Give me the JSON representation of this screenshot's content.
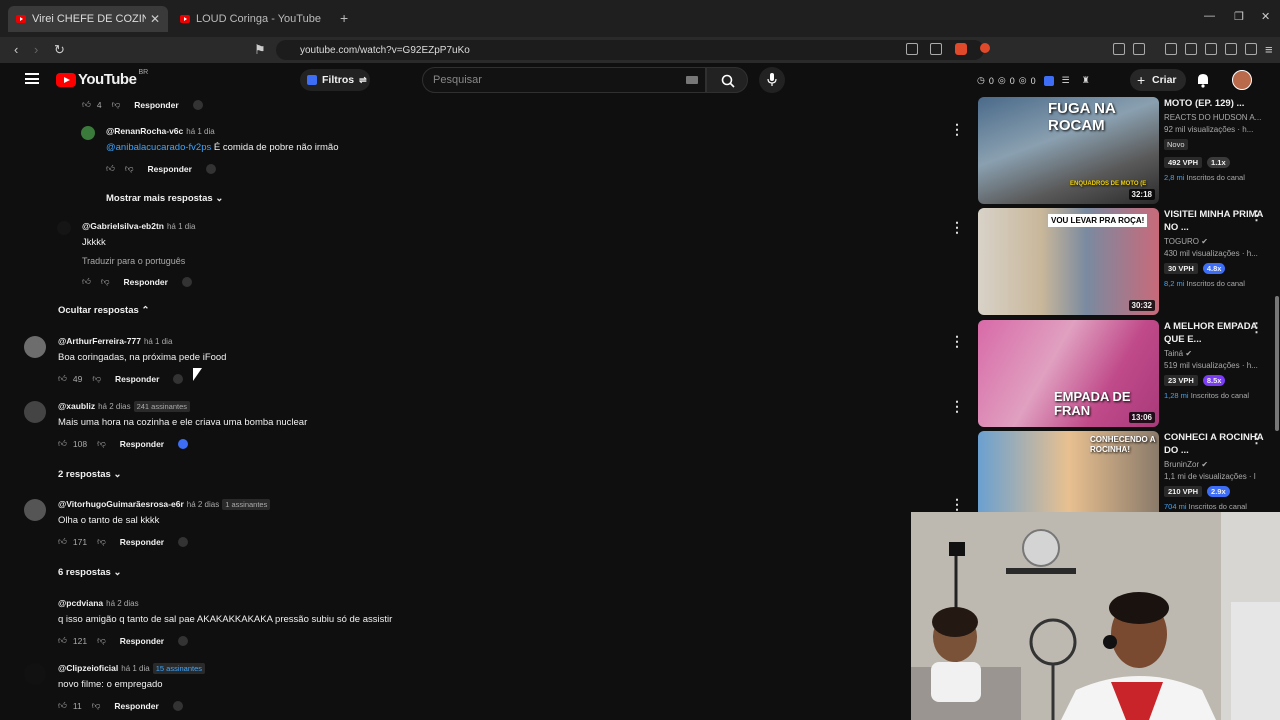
{
  "browser": {
    "tabs": [
      {
        "title": "Virei CHEFE DE COZINHA para S",
        "active": true
      },
      {
        "title": "LOUD Coringa - YouTube",
        "active": false
      }
    ],
    "url": "youtube.com/watch?v=G92EZpP7uKo"
  },
  "header": {
    "logo_text": "YouTube",
    "region": "BR",
    "filtros_label": "Filtros",
    "search_placeholder": "Pesquisar",
    "stats": [
      "0",
      "0",
      "0"
    ],
    "criar_label": "Criar"
  },
  "comments": [
    {
      "type": "actions",
      "likes": "4",
      "reply": "Responder"
    },
    {
      "type": "comment",
      "user": "@RenanRocha-v6c",
      "when": "há 1 dia",
      "mention": "@anibalacucarado-fv2ps",
      "text": "É comida de pobre não irmão",
      "likes": "",
      "reply": "Responder"
    },
    {
      "type": "toggle",
      "label": "Mostrar mais respostas"
    },
    {
      "type": "comment",
      "user": "@Gabrielsilva-eb2tn",
      "when": "há 1 dia",
      "text": "Jkkkk",
      "translate": "Traduzir para o português",
      "likes": "",
      "reply": "Responder"
    },
    {
      "type": "toggle",
      "label": "Ocultar respostas"
    },
    {
      "type": "comment",
      "user": "@ArthurFerreira-777",
      "when": "há 1 dia",
      "text": "Boa coringadas, na próxima pede iFood",
      "likes": "49",
      "reply": "Responder"
    },
    {
      "type": "comment",
      "user": "@xaubliz",
      "when": "há 2 dias",
      "subscribers": "241 assinantes",
      "text": "Mais uma hora na cozinha e ele criava uma bomba nuclear",
      "likes": "108",
      "reply": "Responder"
    },
    {
      "type": "toggle",
      "label": "2 respostas"
    },
    {
      "type": "comment",
      "user": "@VitorhugoGuimarãesrosa-e6r",
      "when": "há 2 dias",
      "subscribers": "1 assinantes",
      "text": "Olha o tanto de sal kkkk",
      "likes": "171",
      "reply": "Responder"
    },
    {
      "type": "toggle",
      "label": "6 respostas"
    },
    {
      "type": "comment",
      "user": "@pcdviana",
      "when": "há 2 dias",
      "text": "q isso amigão q tanto de sal pae AKAKAKKAKAKA pressão subiu só de assistir",
      "likes": "121",
      "reply": "Responder"
    },
    {
      "type": "comment",
      "user": "@Clipzeioficial",
      "when": "há 1 dia",
      "subscribers": "15 assinantes",
      "text": "novo filme: o empregado",
      "likes": "11",
      "reply": "Responder"
    }
  ],
  "sidebar": [
    {
      "title": "MOTO (EP. 129) ...",
      "channel": "REACTS DO HUDSON A...",
      "views": "92 mil visualizações · h...",
      "badge": "Novo",
      "vph": "492 VPH",
      "mult": "1.1x",
      "subs_n": "2,8 mi",
      "subs_label": "Inscritos do canal",
      "duration": "32:18",
      "thumb_text": "FUGA NA ROCAM",
      "thumb_sub": "ENQUADROS DE MOTO (E"
    },
    {
      "title": "VISITEI MINHA PRIMA NO ...",
      "channel": "TOGURO",
      "views": "430 mil visualizações · h...",
      "vph": "30 VPH",
      "mult": "4.8x",
      "subs_n": "8,2 mi",
      "subs_label": "Inscritos do canal",
      "duration": "30:32",
      "thumb_text": "VOU LEVAR PRA ROÇA!"
    },
    {
      "title": "A MELHOR EMPADA QUE E...",
      "channel": "Tainá",
      "views": "519 mil visualizações · h...",
      "vph": "23 VPH",
      "mult": "8.5x",
      "subs_n": "1,28 mi",
      "subs_label": "Inscritos do canal",
      "duration": "13:06",
      "thumb_text": "EMPADA DE FRAN"
    },
    {
      "title": "CONHECI A ROCINHA DO ...",
      "channel": "BruninZor",
      "views": "1,1 mi de visualizações · l",
      "vph": "210 VPH",
      "mult": "2.9x",
      "subs_n": "704 mi",
      "subs_label": "Inscritos do canal",
      "duration": "",
      "thumb_text": "CONHECENDO A ROCINHA!"
    }
  ]
}
